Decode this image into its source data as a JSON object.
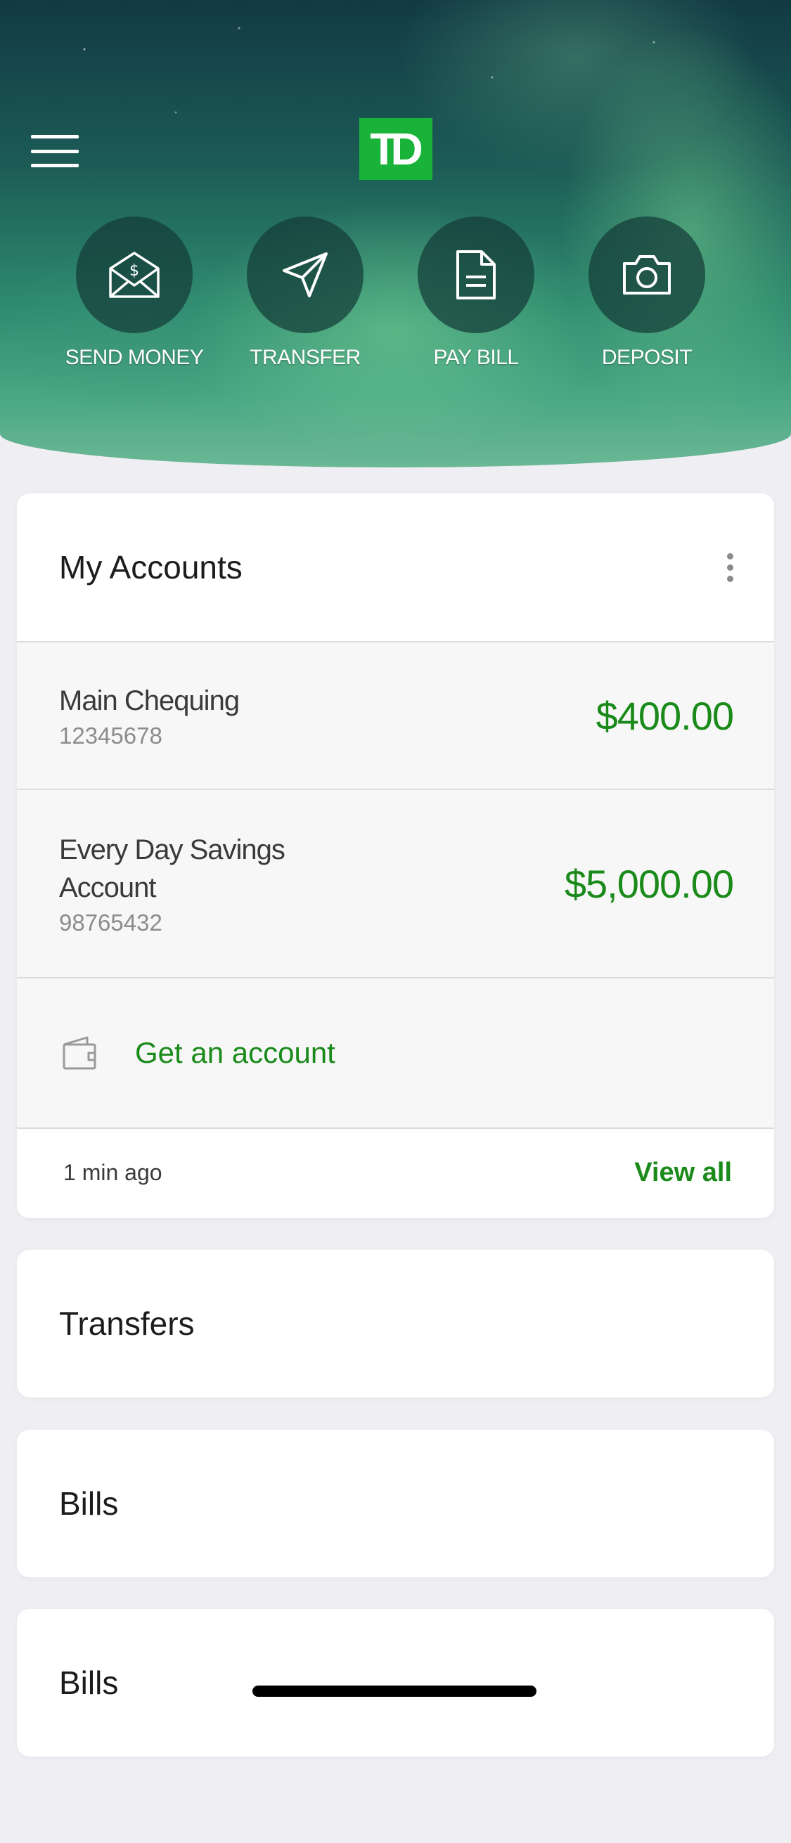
{
  "header": {
    "logo_text": "TD",
    "logo_color": "#1ab33a"
  },
  "actions": [
    {
      "label": "SEND MONEY",
      "icon": "envelope-dollar-icon"
    },
    {
      "label": "TRANSFER",
      "icon": "paper-plane-icon"
    },
    {
      "label": "PAY BILL",
      "icon": "document-icon"
    },
    {
      "label": "DEPOSIT",
      "icon": "camera-icon"
    }
  ],
  "accounts_card": {
    "title": "My Accounts",
    "accounts": [
      {
        "name": "Main Chequing",
        "number": "12345678",
        "balance": "$400.00"
      },
      {
        "name": "Every Day Savings Account",
        "number": "98765432",
        "balance": "$5,000.00"
      }
    ],
    "get_account_label": "Get an account",
    "updated": "1 min ago",
    "view_all_label": "View all"
  },
  "sections": [
    {
      "title": "Transfers"
    },
    {
      "title": "Bills"
    },
    {
      "title": "Bills"
    }
  ],
  "colors": {
    "accent_green": "#1a8a1a",
    "background": "#efeef3"
  }
}
